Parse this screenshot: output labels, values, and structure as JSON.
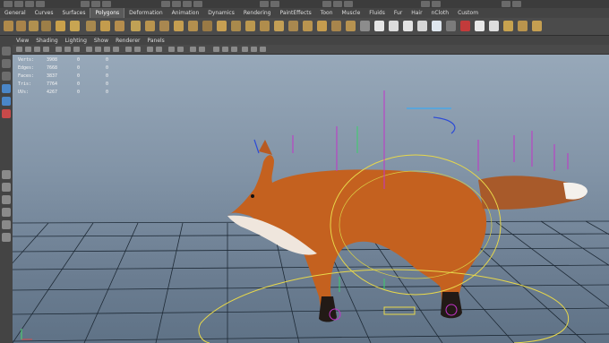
{
  "shelf_tabs": [
    "General",
    "Curves",
    "Surfaces",
    "Polygons",
    "Deformation",
    "Animation",
    "Dynamics",
    "Rendering",
    "PaintEffects",
    "Toon",
    "Muscle",
    "Fluids",
    "Fur",
    "Hair",
    "nCloth",
    "Custom"
  ],
  "active_shelf": "Polygons",
  "panel_menu": [
    "View",
    "Shading",
    "Lighting",
    "Show",
    "Renderer",
    "Panels"
  ],
  "heads_up": {
    "rows": [
      {
        "label": "Verts:",
        "value": "3908",
        "sel": "0",
        "comp": "0"
      },
      {
        "label": "Edges:",
        "value": "7668",
        "sel": "0",
        "comp": "0"
      },
      {
        "label": "Faces:",
        "value": "3837",
        "sel": "0",
        "comp": "0"
      },
      {
        "label": "Tris:",
        "value": "7764",
        "sel": "0",
        "comp": "0"
      },
      {
        "label": "UVs:",
        "value": "4267",
        "sel": "0",
        "comp": "0"
      }
    ]
  },
  "colors": {
    "viewport_top": "#97a8b9",
    "viewport_bottom": "#5f7286",
    "grid": "#1e2a36",
    "control_yellow": "#e8d84a",
    "joint_magenta": "#c233c9",
    "fox_orange": "#c4611f"
  },
  "icons": {
    "toolbox": [
      "select-arrow-icon",
      "lasso-icon",
      "paint-select-icon",
      "move-icon",
      "rotate-icon",
      "scale-icon",
      "layout-single-icon",
      "layout-four-icon",
      "layout-split-icon",
      "outliner-icon"
    ]
  }
}
